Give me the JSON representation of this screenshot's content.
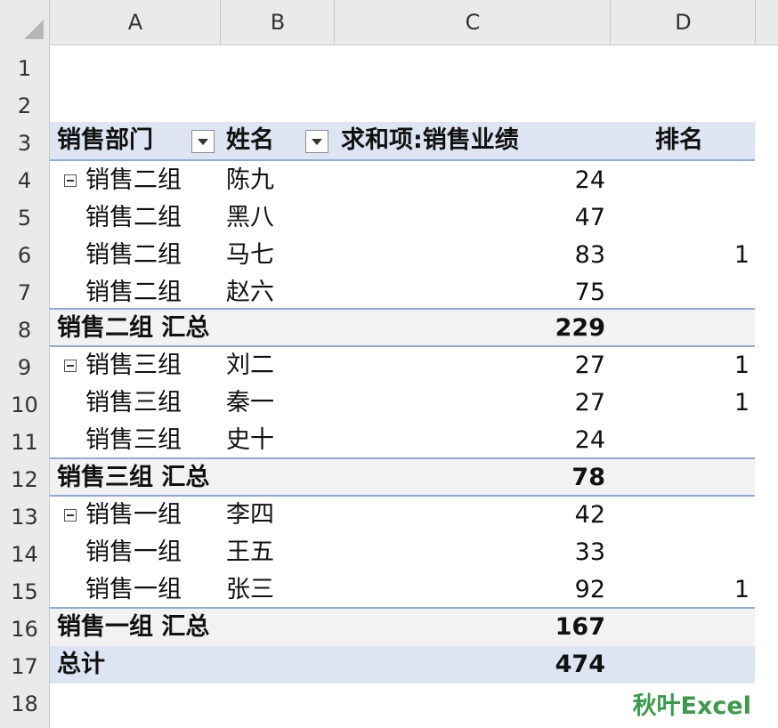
{
  "columns": [
    "A",
    "B",
    "C",
    "D"
  ],
  "rows": [
    "1",
    "2",
    "3",
    "4",
    "5",
    "6",
    "7",
    "8",
    "9",
    "10",
    "11",
    "12",
    "13",
    "14",
    "15",
    "16",
    "17",
    "18"
  ],
  "pivot": {
    "header": {
      "dept": "销售部门",
      "name": "姓名",
      "sum": "求和项:销售业绩",
      "rank": "排名"
    },
    "data": [
      {
        "dept": "销售二组",
        "name": "陈九",
        "value": "24",
        "rank": ""
      },
      {
        "dept": "销售二组",
        "name": "黑八",
        "value": "47",
        "rank": ""
      },
      {
        "dept": "销售二组",
        "name": "马七",
        "value": "83",
        "rank": "1"
      },
      {
        "dept": "销售二组",
        "name": "赵六",
        "value": "75",
        "rank": ""
      },
      {
        "label": "销售二组 汇总",
        "value": "229"
      },
      {
        "dept": "销售三组",
        "name": "刘二",
        "value": "27",
        "rank": "1"
      },
      {
        "dept": "销售三组",
        "name": "秦一",
        "value": "27",
        "rank": "1"
      },
      {
        "dept": "销售三组",
        "name": "史十",
        "value": "24",
        "rank": ""
      },
      {
        "label": "销售三组 汇总",
        "value": "78"
      },
      {
        "dept": "销售一组",
        "name": "李四",
        "value": "42",
        "rank": ""
      },
      {
        "dept": "销售一组",
        "name": "王五",
        "value": "33",
        "rank": ""
      },
      {
        "dept": "销售一组",
        "name": "张三",
        "value": "92",
        "rank": "1"
      },
      {
        "label": "销售一组 汇总",
        "value": "167"
      },
      {
        "label": "总计",
        "value": "474"
      }
    ]
  },
  "watermark": "秋叶Excel",
  "colors": {
    "accent": "#8ea9db",
    "header_fill": "#dde4f2",
    "watermark": "#3a9c4a"
  }
}
